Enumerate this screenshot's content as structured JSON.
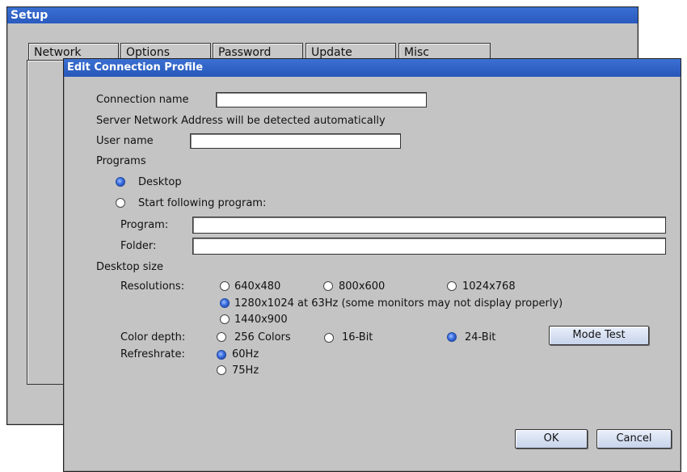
{
  "setup": {
    "title": "Setup",
    "tabs": [
      "Network",
      "Options",
      "Password",
      "Update",
      "Misc"
    ]
  },
  "dialog": {
    "title": "Edit Connection Profile",
    "connection_name_label": "Connection name",
    "connection_name_value": "",
    "server_note": "Server Network Address will be detected automatically",
    "user_name_label": "User name",
    "user_name_value": "",
    "programs_label": "Programs",
    "desktop_label": "Desktop",
    "start_program_label": "Start following program:",
    "program_label": "Program:",
    "program_value": "",
    "folder_label": "Folder:",
    "folder_value": "",
    "desktop_size_label": "Desktop size",
    "resolutions_label": "Resolutions:",
    "resolutions": {
      "r640": "640x480",
      "r800": "800x600",
      "r1024": "1024x768",
      "r1280": "1280x1024 at 63Hz (some monitors may not display properly)",
      "r1440": "1440x900"
    },
    "selected_resolution": "1280x1024 at 63Hz (some monitors may not display properly)",
    "color_depth_label": "Color depth:",
    "color_depths": {
      "c256": "256 Colors",
      "c16": "16-Bit",
      "c24": "24-Bit"
    },
    "selected_color_depth": "24-Bit",
    "mode_test_label": "Mode Test",
    "refresh_label": "Refreshrate:",
    "refresh_rates": {
      "f60": "60Hz",
      "f75": "75Hz"
    },
    "selected_refresh": "60Hz",
    "ok_label": "OK",
    "cancel_label": "Cancel"
  },
  "colors": {
    "titlebar": "#2d62c3",
    "window_bg": "#c4c4c4",
    "radio_selected": "#3a6de0"
  }
}
